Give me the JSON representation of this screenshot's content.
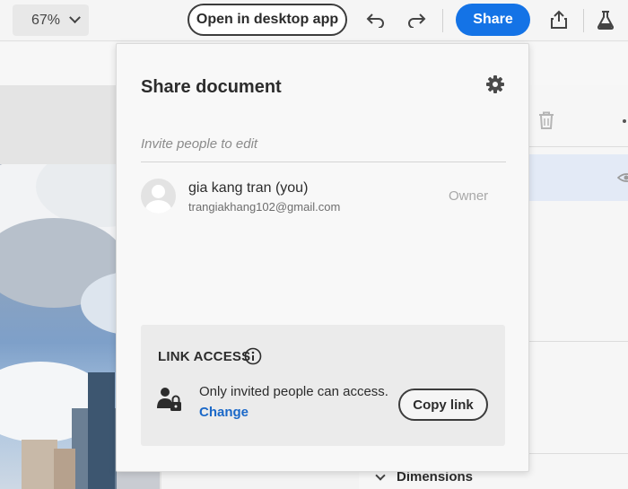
{
  "toolbar": {
    "zoom_value": "67%",
    "open_desktop_label": "Open in desktop app",
    "share_label": "Share"
  },
  "icons": {
    "zoom_dropdown": "chevron-down-icon",
    "undo": "undo-icon",
    "redo": "redo-icon",
    "export": "upload-icon",
    "labs": "flask-icon",
    "settings": "gear-icon",
    "delete": "trash-icon",
    "visibility": "eye-icon",
    "info": "info-icon",
    "restricted": "user-lock-icon"
  },
  "share_dialog": {
    "title": "Share document",
    "invite_placeholder": "Invite people to edit",
    "collaborators": [
      {
        "name": "gia kang tran (you)",
        "email": "trangiakhang102@gmail.com",
        "role": "Owner"
      }
    ],
    "link_access": {
      "title": "LINK ACCESS",
      "status": "Only invited people can access.",
      "change_label": "Change",
      "copy_label": "Copy link"
    }
  },
  "properties_panel": {
    "dimensions_label": "Dimensions"
  },
  "colors": {
    "accent": "#1473e6",
    "link": "#1a68c8",
    "text": "#2c2c2c"
  }
}
